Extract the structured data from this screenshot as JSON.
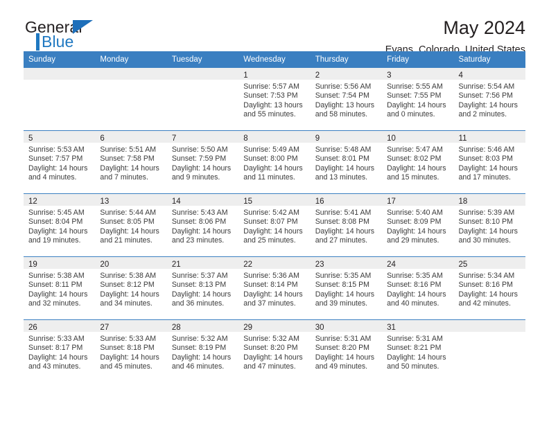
{
  "brand": {
    "name_part1": "General",
    "name_part2": "Blue",
    "logo_icon": "triangle-flag-icon"
  },
  "header": {
    "month_title": "May 2024",
    "location": "Evans, Colorado, United States"
  },
  "colors": {
    "header_blue": "#3a7fc1",
    "brand_blue": "#1f78c1",
    "daybar_gray": "#eeeeee",
    "text": "#231f20"
  },
  "calendar": {
    "weekdays": [
      "Sunday",
      "Monday",
      "Tuesday",
      "Wednesday",
      "Thursday",
      "Friday",
      "Saturday"
    ],
    "labels": {
      "sunrise": "Sunrise:",
      "sunset": "Sunset:",
      "daylight": "Daylight:"
    },
    "weeks": [
      [
        {
          "day": "",
          "sunrise": "",
          "sunset": "",
          "daylight_line1": "",
          "daylight_line2": ""
        },
        {
          "day": "",
          "sunrise": "",
          "sunset": "",
          "daylight_line1": "",
          "daylight_line2": ""
        },
        {
          "day": "",
          "sunrise": "",
          "sunset": "",
          "daylight_line1": "",
          "daylight_line2": ""
        },
        {
          "day": "1",
          "sunrise": "Sunrise: 5:57 AM",
          "sunset": "Sunset: 7:53 PM",
          "daylight_line1": "Daylight: 13 hours",
          "daylight_line2": "and 55 minutes."
        },
        {
          "day": "2",
          "sunrise": "Sunrise: 5:56 AM",
          "sunset": "Sunset: 7:54 PM",
          "daylight_line1": "Daylight: 13 hours",
          "daylight_line2": "and 58 minutes."
        },
        {
          "day": "3",
          "sunrise": "Sunrise: 5:55 AM",
          "sunset": "Sunset: 7:55 PM",
          "daylight_line1": "Daylight: 14 hours",
          "daylight_line2": "and 0 minutes."
        },
        {
          "day": "4",
          "sunrise": "Sunrise: 5:54 AM",
          "sunset": "Sunset: 7:56 PM",
          "daylight_line1": "Daylight: 14 hours",
          "daylight_line2": "and 2 minutes."
        }
      ],
      [
        {
          "day": "5",
          "sunrise": "Sunrise: 5:53 AM",
          "sunset": "Sunset: 7:57 PM",
          "daylight_line1": "Daylight: 14 hours",
          "daylight_line2": "and 4 minutes."
        },
        {
          "day": "6",
          "sunrise": "Sunrise: 5:51 AM",
          "sunset": "Sunset: 7:58 PM",
          "daylight_line1": "Daylight: 14 hours",
          "daylight_line2": "and 7 minutes."
        },
        {
          "day": "7",
          "sunrise": "Sunrise: 5:50 AM",
          "sunset": "Sunset: 7:59 PM",
          "daylight_line1": "Daylight: 14 hours",
          "daylight_line2": "and 9 minutes."
        },
        {
          "day": "8",
          "sunrise": "Sunrise: 5:49 AM",
          "sunset": "Sunset: 8:00 PM",
          "daylight_line1": "Daylight: 14 hours",
          "daylight_line2": "and 11 minutes."
        },
        {
          "day": "9",
          "sunrise": "Sunrise: 5:48 AM",
          "sunset": "Sunset: 8:01 PM",
          "daylight_line1": "Daylight: 14 hours",
          "daylight_line2": "and 13 minutes."
        },
        {
          "day": "10",
          "sunrise": "Sunrise: 5:47 AM",
          "sunset": "Sunset: 8:02 PM",
          "daylight_line1": "Daylight: 14 hours",
          "daylight_line2": "and 15 minutes."
        },
        {
          "day": "11",
          "sunrise": "Sunrise: 5:46 AM",
          "sunset": "Sunset: 8:03 PM",
          "daylight_line1": "Daylight: 14 hours",
          "daylight_line2": "and 17 minutes."
        }
      ],
      [
        {
          "day": "12",
          "sunrise": "Sunrise: 5:45 AM",
          "sunset": "Sunset: 8:04 PM",
          "daylight_line1": "Daylight: 14 hours",
          "daylight_line2": "and 19 minutes."
        },
        {
          "day": "13",
          "sunrise": "Sunrise: 5:44 AM",
          "sunset": "Sunset: 8:05 PM",
          "daylight_line1": "Daylight: 14 hours",
          "daylight_line2": "and 21 minutes."
        },
        {
          "day": "14",
          "sunrise": "Sunrise: 5:43 AM",
          "sunset": "Sunset: 8:06 PM",
          "daylight_line1": "Daylight: 14 hours",
          "daylight_line2": "and 23 minutes."
        },
        {
          "day": "15",
          "sunrise": "Sunrise: 5:42 AM",
          "sunset": "Sunset: 8:07 PM",
          "daylight_line1": "Daylight: 14 hours",
          "daylight_line2": "and 25 minutes."
        },
        {
          "day": "16",
          "sunrise": "Sunrise: 5:41 AM",
          "sunset": "Sunset: 8:08 PM",
          "daylight_line1": "Daylight: 14 hours",
          "daylight_line2": "and 27 minutes."
        },
        {
          "day": "17",
          "sunrise": "Sunrise: 5:40 AM",
          "sunset": "Sunset: 8:09 PM",
          "daylight_line1": "Daylight: 14 hours",
          "daylight_line2": "and 29 minutes."
        },
        {
          "day": "18",
          "sunrise": "Sunrise: 5:39 AM",
          "sunset": "Sunset: 8:10 PM",
          "daylight_line1": "Daylight: 14 hours",
          "daylight_line2": "and 30 minutes."
        }
      ],
      [
        {
          "day": "19",
          "sunrise": "Sunrise: 5:38 AM",
          "sunset": "Sunset: 8:11 PM",
          "daylight_line1": "Daylight: 14 hours",
          "daylight_line2": "and 32 minutes."
        },
        {
          "day": "20",
          "sunrise": "Sunrise: 5:38 AM",
          "sunset": "Sunset: 8:12 PM",
          "daylight_line1": "Daylight: 14 hours",
          "daylight_line2": "and 34 minutes."
        },
        {
          "day": "21",
          "sunrise": "Sunrise: 5:37 AM",
          "sunset": "Sunset: 8:13 PM",
          "daylight_line1": "Daylight: 14 hours",
          "daylight_line2": "and 36 minutes."
        },
        {
          "day": "22",
          "sunrise": "Sunrise: 5:36 AM",
          "sunset": "Sunset: 8:14 PM",
          "daylight_line1": "Daylight: 14 hours",
          "daylight_line2": "and 37 minutes."
        },
        {
          "day": "23",
          "sunrise": "Sunrise: 5:35 AM",
          "sunset": "Sunset: 8:15 PM",
          "daylight_line1": "Daylight: 14 hours",
          "daylight_line2": "and 39 minutes."
        },
        {
          "day": "24",
          "sunrise": "Sunrise: 5:35 AM",
          "sunset": "Sunset: 8:16 PM",
          "daylight_line1": "Daylight: 14 hours",
          "daylight_line2": "and 40 minutes."
        },
        {
          "day": "25",
          "sunrise": "Sunrise: 5:34 AM",
          "sunset": "Sunset: 8:16 PM",
          "daylight_line1": "Daylight: 14 hours",
          "daylight_line2": "and 42 minutes."
        }
      ],
      [
        {
          "day": "26",
          "sunrise": "Sunrise: 5:33 AM",
          "sunset": "Sunset: 8:17 PM",
          "daylight_line1": "Daylight: 14 hours",
          "daylight_line2": "and 43 minutes."
        },
        {
          "day": "27",
          "sunrise": "Sunrise: 5:33 AM",
          "sunset": "Sunset: 8:18 PM",
          "daylight_line1": "Daylight: 14 hours",
          "daylight_line2": "and 45 minutes."
        },
        {
          "day": "28",
          "sunrise": "Sunrise: 5:32 AM",
          "sunset": "Sunset: 8:19 PM",
          "daylight_line1": "Daylight: 14 hours",
          "daylight_line2": "and 46 minutes."
        },
        {
          "day": "29",
          "sunrise": "Sunrise: 5:32 AM",
          "sunset": "Sunset: 8:20 PM",
          "daylight_line1": "Daylight: 14 hours",
          "daylight_line2": "and 47 minutes."
        },
        {
          "day": "30",
          "sunrise": "Sunrise: 5:31 AM",
          "sunset": "Sunset: 8:20 PM",
          "daylight_line1": "Daylight: 14 hours",
          "daylight_line2": "and 49 minutes."
        },
        {
          "day": "31",
          "sunrise": "Sunrise: 5:31 AM",
          "sunset": "Sunset: 8:21 PM",
          "daylight_line1": "Daylight: 14 hours",
          "daylight_line2": "and 50 minutes."
        },
        {
          "day": "",
          "sunrise": "",
          "sunset": "",
          "daylight_line1": "",
          "daylight_line2": ""
        }
      ]
    ]
  }
}
